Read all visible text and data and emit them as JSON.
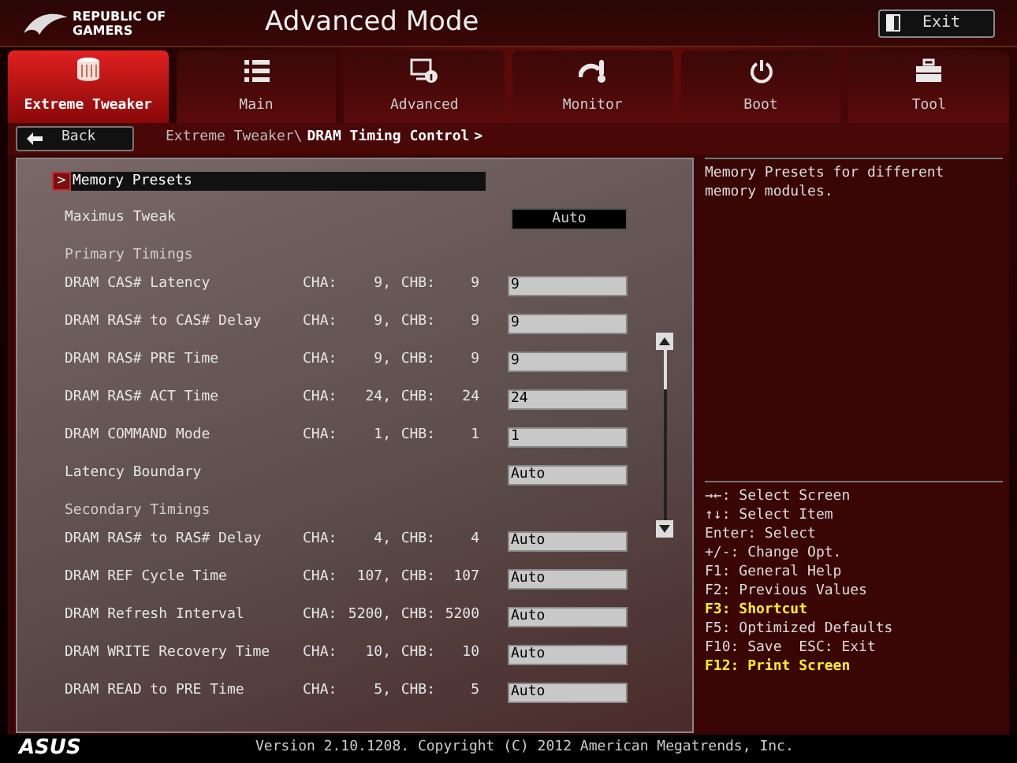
{
  "header": {
    "logo": [
      "REPUBLIC OF",
      "GAMERS"
    ],
    "title": "Advanced Mode",
    "exit": "Exit"
  },
  "tabs": [
    {
      "label": "Extreme Tweaker",
      "kind": "tweaker",
      "selected": true
    },
    {
      "label": "Main",
      "kind": "main",
      "selected": false
    },
    {
      "label": "Advanced",
      "kind": "advanced",
      "selected": false
    },
    {
      "label": "Monitor",
      "kind": "monitor",
      "selected": false
    },
    {
      "label": "Boot",
      "kind": "boot",
      "selected": false
    },
    {
      "label": "Tool",
      "kind": "tool",
      "selected": false
    }
  ],
  "navigation": {
    "back": "Back",
    "path": "Extreme Tweaker\\",
    "current": "DRAM Timing Control",
    "arrow": ">"
  },
  "settings": [
    {
      "kind": "submenu",
      "marker": ">",
      "label": "Memory Presets",
      "selected": true
    },
    {
      "kind": "select",
      "label": "Maximus Tweak",
      "value": "Auto"
    },
    {
      "kind": "heading",
      "label": "Primary Timings"
    },
    {
      "kind": "timing",
      "label": "DRAM CAS# Latency",
      "reading": [
        "CHA:",
        "9,",
        "CHB:",
        "9"
      ],
      "value": "9"
    },
    {
      "kind": "timing",
      "label": "DRAM RAS# to CAS# Delay",
      "reading": [
        "CHA:",
        "9,",
        "CHB:",
        "9"
      ],
      "value": "9"
    },
    {
      "kind": "timing",
      "label": "DRAM RAS# PRE Time",
      "reading": [
        "CHA:",
        "9,",
        "CHB:",
        "9"
      ],
      "value": "9"
    },
    {
      "kind": "timing",
      "label": "DRAM RAS# ACT Time",
      "reading": [
        "CHA:",
        "24,",
        "CHB:",
        "24"
      ],
      "value": "24"
    },
    {
      "kind": "timing",
      "label": "DRAM COMMAND Mode",
      "reading": [
        "CHA:",
        "1,",
        "CHB:",
        "1"
      ],
      "value": "1"
    },
    {
      "kind": "timing",
      "label": "Latency Boundary",
      "value": "Auto"
    },
    {
      "kind": "heading",
      "label": "Secondary Timings"
    },
    {
      "kind": "timing",
      "label": "DRAM RAS# to RAS# Delay",
      "reading": [
        "CHA:",
        "4,",
        "CHB:",
        "4"
      ],
      "value": "Auto"
    },
    {
      "kind": "timing",
      "label": "DRAM REF Cycle Time",
      "reading": [
        "CHA:",
        "107,",
        "CHB:",
        "107"
      ],
      "value": "Auto"
    },
    {
      "kind": "timing",
      "label": "DRAM Refresh Interval",
      "reading": [
        "CHA:",
        "5200,",
        "CHB:",
        "5200"
      ],
      "value": "Auto"
    },
    {
      "kind": "timing",
      "label": "DRAM WRITE Recovery Time",
      "reading": [
        "CHA:",
        "10,",
        "CHB:",
        "10"
      ],
      "value": "Auto"
    },
    {
      "kind": "timing",
      "label": "DRAM READ to PRE Time",
      "reading": [
        "CHA:",
        "5,",
        "CHB:",
        "5"
      ],
      "value": "Auto"
    }
  ],
  "help": {
    "description": "Memory Presets for different memory modules.",
    "keys": [
      {
        "text": "→←: Select Screen",
        "highlighted": false
      },
      {
        "text": "↑↓: Select Item",
        "highlighted": false
      },
      {
        "text": "Enter: Select",
        "highlighted": false
      },
      {
        "text": "+/-: Change Opt.",
        "highlighted": false
      },
      {
        "text": "F1: General Help",
        "highlighted": false
      },
      {
        "text": "F2: Previous Values",
        "highlighted": false
      },
      {
        "text": "F3: Shortcut",
        "highlighted": true
      },
      {
        "text": "F5: Optimized Defaults",
        "highlighted": false
      },
      {
        "text": "F10: Save  ESC: Exit",
        "highlighted": false
      },
      {
        "text": "F12: Print Screen",
        "highlighted": true
      }
    ]
  },
  "footer": {
    "logo": "ASUS",
    "version": "Version 2.10.1208. Copyright (C) 2012 American Megatrends, Inc."
  }
}
